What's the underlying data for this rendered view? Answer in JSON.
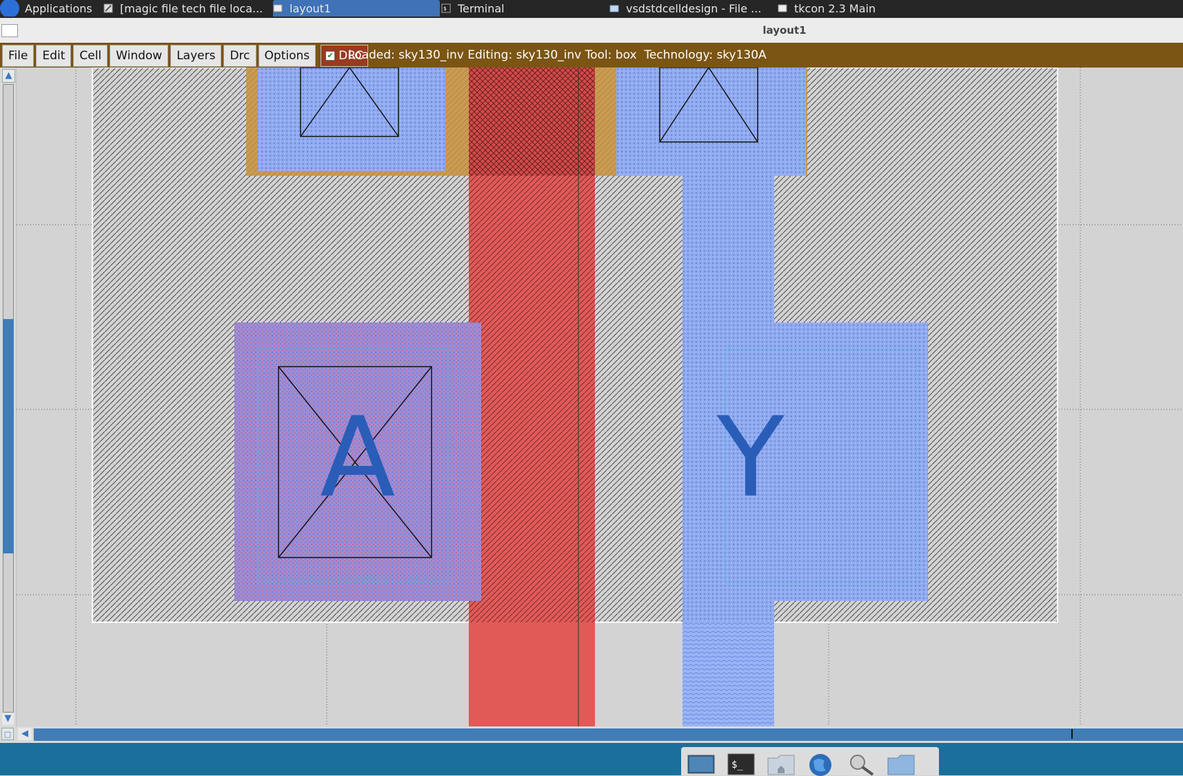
{
  "taskbar": {
    "applications_label": "Applications",
    "tasks": [
      {
        "label": "[magic file tech file loca...",
        "active": false
      },
      {
        "label": "layout1",
        "active": true
      },
      {
        "label": "Terminal",
        "active": false
      },
      {
        "label": "vsdstdcelldesign - File ...",
        "active": false
      },
      {
        "label": "tkcon 2.3 Main",
        "active": false
      }
    ]
  },
  "window": {
    "title": "layout1"
  },
  "menu": {
    "items": [
      "File",
      "Edit",
      "Cell",
      "Window",
      "Layers",
      "Drc",
      "Options"
    ],
    "drc_toggle": {
      "label": "DRC",
      "checked": true
    }
  },
  "status": {
    "text": "Loaded: sky130_inv Editing: sky130_inv Tool: box  Technology: sky130A"
  },
  "layout": {
    "pins": [
      {
        "label": "A"
      },
      {
        "label": "Y"
      }
    ],
    "colors": {
      "background": "#d3d3d3",
      "poly": "#e05a58",
      "locali": "#8aa6f2",
      "diffusion_outline": "#c8903c",
      "cell_boundary_hatch": "#555555",
      "pin_label": "#2a5db8",
      "menubar": "#7b5513",
      "scrollbar_accent": "#3f7cb8"
    }
  },
  "dock": {
    "icons": [
      "desktop-icon",
      "terminal-icon",
      "home-folder-icon",
      "web-browser-icon",
      "search-icon",
      "files-icon"
    ]
  }
}
